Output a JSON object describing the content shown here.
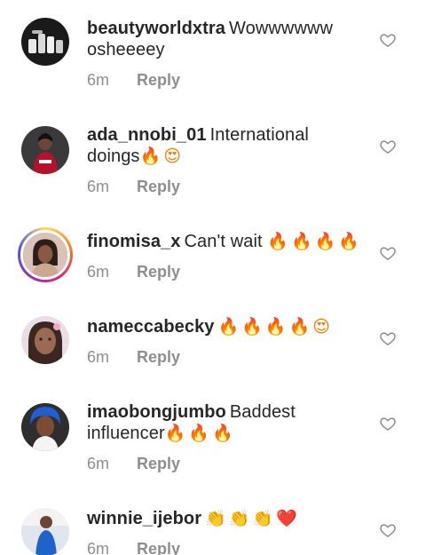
{
  "comments": [
    {
      "username": "beautyworldxtra",
      "text": "Wowwwwww osheeeey",
      "emojis": "",
      "time": "6m",
      "reply": "Reply",
      "avatar": "product-photo-avatar",
      "story_ring": false
    },
    {
      "username": "ada_nnobi_01",
      "text": "International doings",
      "emojis": "🔥😍",
      "time": "6m",
      "reply": "Reply",
      "avatar": "person-red-outfit-avatar",
      "story_ring": false
    },
    {
      "username": "finomisa_x",
      "text": "Can't wait",
      "emojis": "🔥🔥🔥🔥",
      "time": "6m",
      "reply": "Reply",
      "avatar": "person-portrait-avatar",
      "story_ring": true
    },
    {
      "username": "nameccabecky",
      "text": "",
      "emojis": "🔥🔥🔥🔥😍",
      "time": "6m",
      "reply": "Reply",
      "avatar": "person-closeup-avatar",
      "story_ring": false
    },
    {
      "username": "imaobongjumbo",
      "text": "Baddest influencer",
      "emojis": "🔥🔥🔥",
      "time": "6m",
      "reply": "Reply",
      "avatar": "person-blue-headwrap-avatar",
      "story_ring": false
    },
    {
      "username": "winnie_ijebor",
      "text": "",
      "emojis": "👏👏👏❤️",
      "time": "6m",
      "reply": "Reply",
      "avatar": "person-blue-dress-avatar",
      "story_ring": false
    }
  ],
  "colors": {
    "username": "#262626",
    "meta": "#8e8e8e",
    "heart_outline": "#8e8e8e",
    "story_ring": [
      "#feda75",
      "#fa7e1e",
      "#d62976",
      "#962fbf",
      "#4f5bd5"
    ]
  },
  "icons": {
    "like": "heart-outline-icon"
  }
}
